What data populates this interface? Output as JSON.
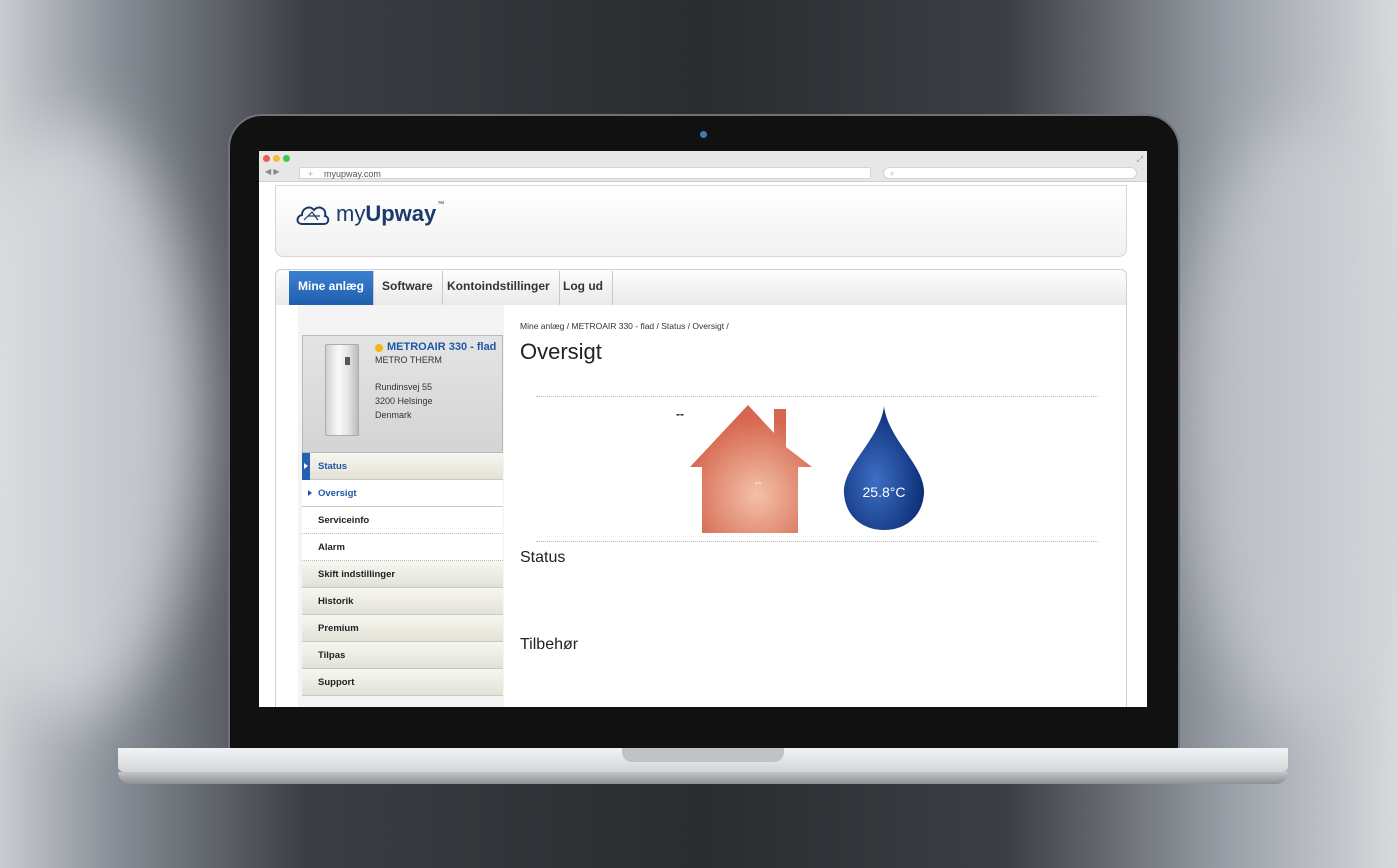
{
  "browser": {
    "url": "myupway.com"
  },
  "site": {
    "logo_prefix": "my",
    "logo_bold": "Upway",
    "logo_tm": "™"
  },
  "nav": {
    "tabs": [
      {
        "label": "Mine anlæg",
        "active": true
      },
      {
        "label": "Software"
      },
      {
        "label": "Kontoindstillinger"
      },
      {
        "label": "Log ud"
      }
    ]
  },
  "device": {
    "name": "METROAIR 330 - flad",
    "brand": "METRO THERM",
    "address_line1": "Rundinsvej 55",
    "address_line2": "3200 Helsinge",
    "country": "Denmark",
    "status_color": "#f2b90c"
  },
  "sidebar": {
    "items": [
      {
        "label": "Status"
      },
      {
        "label": "Oversigt"
      },
      {
        "label": "Serviceinfo"
      },
      {
        "label": "Alarm"
      },
      {
        "label": "Skift indstillinger"
      },
      {
        "label": "Historik"
      },
      {
        "label": "Premium"
      },
      {
        "label": "Tilpas"
      },
      {
        "label": "Support"
      }
    ]
  },
  "main": {
    "breadcrumb": "Mine anlæg / METROAIR 330 - flad / Status / Oversigt /",
    "title": "Oversigt",
    "outdoor_value": "--",
    "indoor_value": "--",
    "hot_water_value": "25.8°C",
    "status_heading": "Status",
    "accessories_heading": "Tilbehør"
  },
  "colors": {
    "accent": "#2060b5",
    "house": "#d9735f",
    "water": "#1e4fa0"
  }
}
